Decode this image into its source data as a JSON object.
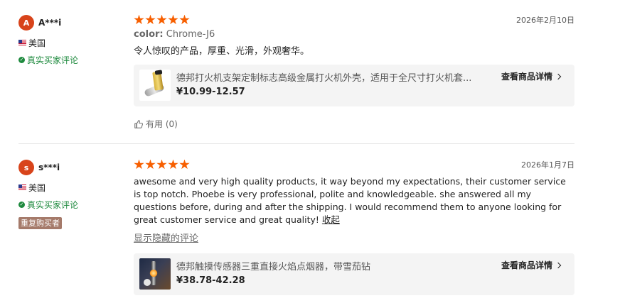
{
  "reviews": [
    {
      "avatar_letter": "A",
      "username": "A***i",
      "country": "美国",
      "verified_label": "真实买家评论",
      "rating": 5,
      "date": "2026年2月10日",
      "sku_label": "color:",
      "sku_value": "Chrome-J6",
      "text": "令人惊叹的产品，厚重、光滑，外观奢华。",
      "product": {
        "title": "德邦打火机支架定制标志高级金属打火机外壳，适用于全尺寸打火机套...",
        "price": "¥10.99-12.57",
        "detail_label": "查看商品详情"
      },
      "helpful_label": "有用 (0)"
    },
    {
      "avatar_letter": "s",
      "username": "s***i",
      "country": "美国",
      "verified_label": "真实买家评论",
      "badge": "重复购买者",
      "rating": 5,
      "date": "2026年1月7日",
      "text": "awesome and very high quality products, it way beyond my expectations, their customer service is top notch. Phoebe is very professional, polite and knowledgeable. she answered all my questions before, during and after the shipping. I would recommend them to anyone looking for great customer service and great quality!",
      "collapse_label": "收起",
      "show_hidden_label": "显示隐藏的评论",
      "product": {
        "title": "德邦触摸传感器三重直接火焰点烟器，带雪茄钻",
        "price": "¥38.78-42.28",
        "detail_label": "查看商品详情"
      }
    }
  ],
  "icons": {
    "star": "star-icon",
    "verified": "check-circle-icon",
    "flag": "us-flag-icon",
    "chevron": "chevron-right-icon",
    "helpful": "thumbs-up-icon"
  },
  "colors": {
    "star": "#f75f00",
    "verified": "#1e8a3e",
    "avatar": "#d8441b",
    "badge": "#a57a6a",
    "product_card_bg": "#f4f4f4"
  }
}
